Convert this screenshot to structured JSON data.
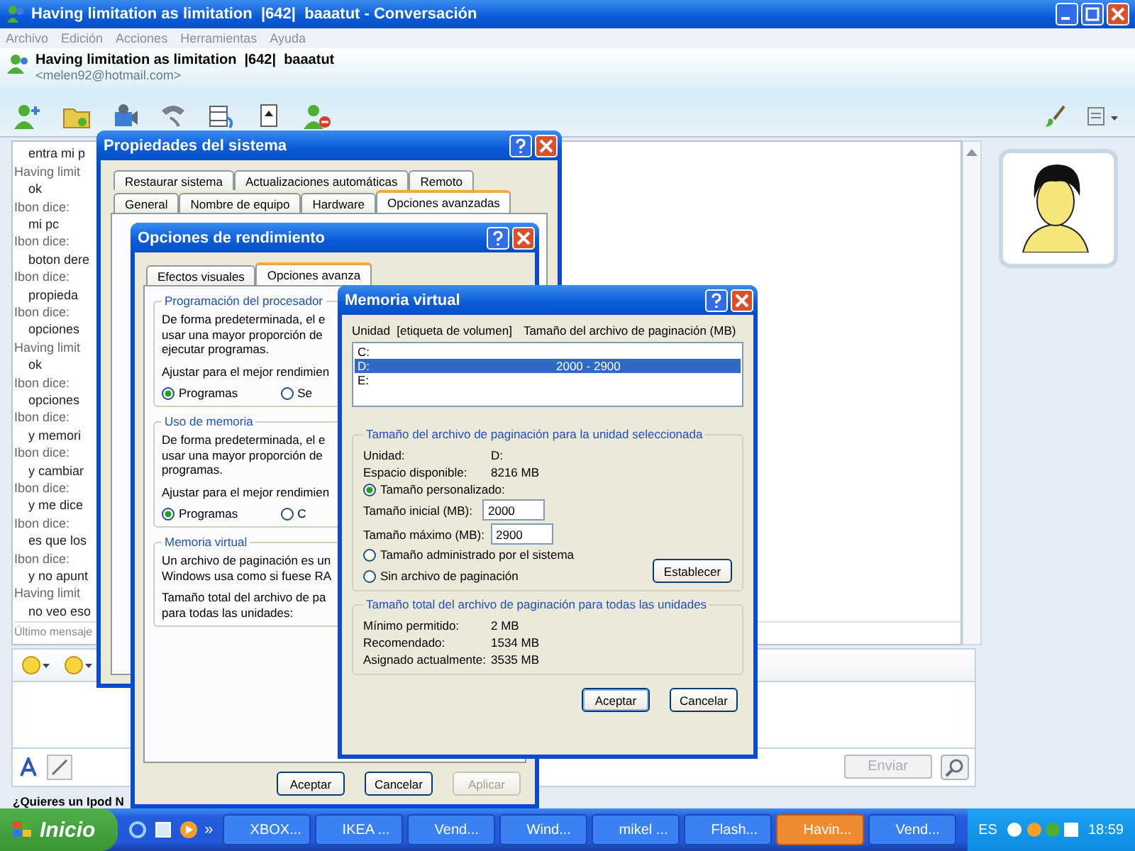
{
  "window": {
    "title": "Having limitation as limitation  |642|  baaatut - Conversación"
  },
  "menu": [
    "Archivo",
    "Edición",
    "Acciones",
    "Herramientas",
    "Ayuda"
  ],
  "contact": {
    "name": "Having limitation as limitation  |642|  baaatut",
    "email": "<melen92@hotmail.com>"
  },
  "chat": {
    "lines": [
      {
        "kind": "message",
        "text": "entra mi p"
      },
      {
        "kind": "sender",
        "text": "Having limit"
      },
      {
        "kind": "message",
        "text": "ok"
      },
      {
        "kind": "sender",
        "text": "Ibon dice:"
      },
      {
        "kind": "message",
        "text": "mi pc"
      },
      {
        "kind": "sender",
        "text": "Ibon dice:"
      },
      {
        "kind": "message",
        "text": "boton dere"
      },
      {
        "kind": "sender",
        "text": "Ibon dice:"
      },
      {
        "kind": "message",
        "text": "propieda"
      },
      {
        "kind": "sender",
        "text": "Ibon dice:"
      },
      {
        "kind": "message",
        "text": "opciones"
      },
      {
        "kind": "sender",
        "text": "Having limit"
      },
      {
        "kind": "message",
        "text": "ok"
      },
      {
        "kind": "sender",
        "text": "Ibon dice:"
      },
      {
        "kind": "message",
        "text": "opciones"
      },
      {
        "kind": "sender",
        "text": "Ibon dice:"
      },
      {
        "kind": "message",
        "text": "y memori"
      },
      {
        "kind": "sender",
        "text": "Ibon dice:"
      },
      {
        "kind": "message",
        "text": "y cambiar"
      },
      {
        "kind": "sender",
        "text": "Ibon dice:"
      },
      {
        "kind": "message",
        "text": "y me dice"
      },
      {
        "kind": "sender",
        "text": "Ibon dice:"
      },
      {
        "kind": "message",
        "text": "es que los"
      },
      {
        "kind": "sender",
        "text": "Ibon dice:"
      },
      {
        "kind": "message",
        "text": "y no apunt"
      },
      {
        "kind": "sender",
        "text": "Having limit"
      },
      {
        "kind": "message",
        "text": "no veo eso"
      }
    ],
    "status": "Último mensaje"
  },
  "composer": {
    "send_button": {
      "label": "Enviar",
      "disabled": true
    }
  },
  "ad": "¿Quieres un Ipod N",
  "system_properties": {
    "title": "Propiedades del sistema",
    "tab_rows": [
      [
        {
          "label": "Restaurar sistema",
          "selected": false
        },
        {
          "label": "Actualizaciones automáticas",
          "selected": false
        },
        {
          "label": "Remoto",
          "selected": false
        }
      ],
      [
        {
          "label": "General",
          "selected": false
        },
        {
          "label": "Nombre de equipo",
          "selected": false
        },
        {
          "label": "Hardware",
          "selected": false
        },
        {
          "label": "Opciones avanzadas",
          "selected": true
        }
      ]
    ]
  },
  "performance_options": {
    "title": "Opciones de rendimiento",
    "tabs": [
      {
        "label": "Efectos visuales",
        "selected": false
      },
      {
        "label": "Opciones avanza",
        "selected": true
      }
    ],
    "groups": [
      {
        "title": "Programación del procesador",
        "lines": [
          "De forma predeterminada, el e",
          "usar una mayor proporción de",
          "ejecutar programas."
        ],
        "prompt": "Ajustar para el mejor rendimien",
        "radios": [
          {
            "label": "Programas",
            "selected": true
          },
          {
            "label": "Se",
            "selected": false
          }
        ]
      },
      {
        "title": "Uso de memoria",
        "lines": [
          "De forma predeterminada, el e",
          "usar una mayor proporción de",
          "programas."
        ],
        "prompt": "Ajustar para el mejor rendimien",
        "radios": [
          {
            "label": "Programas",
            "selected": true
          },
          {
            "label": "C",
            "selected": false
          }
        ]
      },
      {
        "title": "Memoria virtual",
        "lines": [
          "Un archivo de paginación es un",
          "Windows usa como si fuese RA"
        ],
        "prompt": "Tamaño total del archivo de pa",
        "prompt2": "para todas las unidades:"
      }
    ],
    "buttons": [
      {
        "label": "Aceptar",
        "disabled": false
      },
      {
        "label": "Cancelar",
        "disabled": false
      },
      {
        "label": "Aplicar",
        "disabled": true
      }
    ]
  },
  "virtual_memory": {
    "title": "Memoria virtual",
    "columns": [
      "Unidad  [etiqueta de volumen]",
      "Tamaño del archivo de paginación (MB)"
    ],
    "drives": [
      {
        "drive": "C:",
        "selected": false
      },
      {
        "drive": "D:",
        "size": "2000 - 2900",
        "selected": true
      },
      {
        "drive": "E:",
        "selected": false
      }
    ],
    "selected_group": {
      "title": "Tamaño del archivo de paginación para la unidad seleccionada",
      "info": [
        {
          "label": "Unidad:",
          "value": "D:"
        },
        {
          "label": "Espacio disponible:",
          "value": "8216 MB"
        }
      ],
      "custom": {
        "label": "Tamaño personalizado:",
        "selected": true
      },
      "fields": [
        {
          "label": "Tamaño inicial (MB):",
          "value": "2000"
        },
        {
          "label": "Tamaño máximo (MB):",
          "value": "2900"
        }
      ],
      "options": [
        {
          "label": "Tamaño administrado por el sistema",
          "selected": false
        },
        {
          "label": "Sin archivo de paginación",
          "selected": false
        }
      ],
      "set_button": "Establecer"
    },
    "total_group": {
      "title": "Tamaño total del archivo de paginación para todas las unidades",
      "rows": [
        {
          "label": "Mínimo permitido:",
          "value": "2 MB"
        },
        {
          "label": "Recomendado:",
          "value": "1534 MB"
        },
        {
          "label": "Asignado actualmente:",
          "value": "3535 MB"
        }
      ]
    },
    "buttons": [
      "Aceptar",
      "Cancelar"
    ]
  },
  "taskbar": {
    "start": "Inicio",
    "more": "»",
    "tasks": [
      {
        "label": "XBOX...",
        "selected": false
      },
      {
        "label": "IKEA ...",
        "selected": false
      },
      {
        "label": "Vend...",
        "selected": false
      },
      {
        "label": "Wind...",
        "selected": false
      },
      {
        "label": "mikel ...",
        "selected": false
      },
      {
        "label": "Flash...",
        "selected": false
      },
      {
        "label": "Havin...",
        "selected": true
      },
      {
        "label": "Vend...",
        "selected": false
      }
    ],
    "language": "ES",
    "clock": "18:59"
  }
}
